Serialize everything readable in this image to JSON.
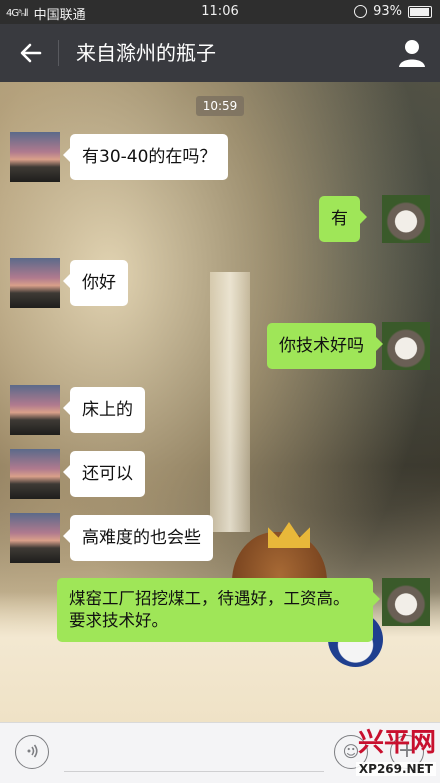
{
  "status_bar": {
    "signal": "4Gᵃₙll",
    "carrier": "中国联通",
    "time": "11:06",
    "battery": "93%"
  },
  "header": {
    "back_icon": "arrow-left-icon",
    "title": "来自滁州的瓶子",
    "profile_icon": "person-icon"
  },
  "chat": {
    "timestamp": "10:59",
    "messages": [
      {
        "side": "in",
        "text": "有30-40的在吗？"
      },
      {
        "side": "out",
        "text": "有"
      },
      {
        "side": "in",
        "text": "你好"
      },
      {
        "side": "out",
        "text": "你技术好吗"
      },
      {
        "side": "in",
        "text": "床上的"
      },
      {
        "side": "in",
        "text": "还可以"
      },
      {
        "side": "in",
        "text": "高难度的也会些"
      },
      {
        "side": "in",
        "text": "煤窑工厂招挖煤工，待遇好，工资高。要求技术好。"
      }
    ]
  },
  "input_bar": {
    "voice_icon": "voice-icon",
    "emoji_icon": "emoji-icon",
    "plus_icon": "plus-icon"
  },
  "watermark": {
    "brand": "兴平网",
    "url": "XP269.NET"
  },
  "colors": {
    "header_bg": "#393a3f",
    "status_bg": "#2e2e2e",
    "bubble_out": "#9fe658",
    "bubble_in": "#ffffff",
    "watermark": "#c8102e"
  }
}
